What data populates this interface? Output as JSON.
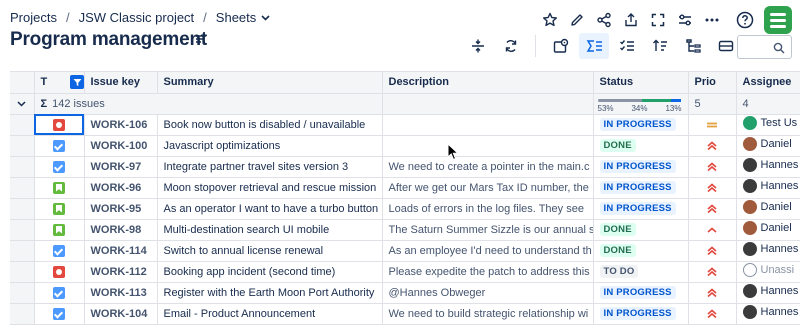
{
  "breadcrumbs": [
    "Projects",
    "JSW Classic project",
    "Sheets"
  ],
  "page_title": "Program management",
  "search": {
    "value": ""
  },
  "columns": {
    "type": "T",
    "key": "Issue key",
    "summary": "Summary",
    "description": "Description",
    "status": "Status",
    "priority": "Prio",
    "assignee": "Assignee"
  },
  "group": {
    "label": "142 issues",
    "sigma": "Σ",
    "status_pcts": [
      "53%",
      "34%",
      "13%"
    ],
    "status_fill": [
      0.53,
      0.34,
      0.13
    ],
    "priority_count": "5",
    "assignee_count": "4"
  },
  "colors": {
    "accent": "#0c66e4",
    "in_progress_bar": "#8993a4",
    "done_bar": "#22a06b",
    "todo_bar": "#0c66e4"
  },
  "rows": [
    {
      "type_icon": "bug-icon",
      "key": "WORK-106",
      "summary": "Book now button is disabled / unavailable",
      "description": "",
      "status": "IN PROGRESS",
      "priority": "medium-priority-icon",
      "assignee": "Test Us"
    },
    {
      "type_icon": "task-icon",
      "key": "WORK-100",
      "summary": "Javascript optimizations",
      "description": "",
      "status": "DONE",
      "priority": "high-priority-icon",
      "assignee": "Daniel"
    },
    {
      "type_icon": "task-icon",
      "key": "WORK-97",
      "summary": "Integrate partner travel sites version 3",
      "description": "We need to create a pointer in the main.c",
      "status": "IN PROGRESS",
      "priority": "high-priority-icon",
      "assignee": "Hannes"
    },
    {
      "type_icon": "story-icon",
      "key": "WORK-96",
      "summary": "Moon stopover retrieval and rescue mission",
      "description": "After we get our Mars Tax ID number, the",
      "status": "IN PROGRESS",
      "priority": "high-priority-icon",
      "assignee": "Hannes"
    },
    {
      "type_icon": "story-icon",
      "key": "WORK-95",
      "summary": "As an operator I want to have a turbo button",
      "description": "Loads of errors in the log files. They see",
      "status": "IN PROGRESS",
      "priority": "high-priority-icon",
      "assignee": "Daniel"
    },
    {
      "type_icon": "story-icon",
      "key": "WORK-98",
      "summary": "Multi-destination search UI mobile",
      "description": "The Saturn Summer Sizzle is our annual s",
      "status": "DONE",
      "priority": "low-priority-icon",
      "assignee": "Daniel"
    },
    {
      "type_icon": "task-icon",
      "key": "WORK-114",
      "summary": "Switch to annual license renewal",
      "description": "As an employee I'd need to understand th",
      "status": "DONE",
      "priority": "high-priority-icon",
      "assignee": "Hannes"
    },
    {
      "type_icon": "bug-icon",
      "key": "WORK-112",
      "summary": "Booking app incident (second time)",
      "description": "Please expedite the patch to address this",
      "status": "TO DO",
      "priority": "high-priority-icon",
      "assignee": "Unassi"
    },
    {
      "type_icon": "task-icon",
      "key": "WORK-113",
      "summary": "Register with the Earth Moon Port Authority",
      "description": "@Hannes Obweger",
      "status": "IN PROGRESS",
      "priority": "high-priority-icon",
      "assignee": "Hannes"
    },
    {
      "type_icon": "task-icon",
      "key": "WORK-104",
      "summary": "Email - Product Announcement",
      "description": "We need to build strategic relationship wi",
      "status": "IN PROGRESS",
      "priority": "high-priority-icon",
      "assignee": "Hannes"
    }
  ]
}
